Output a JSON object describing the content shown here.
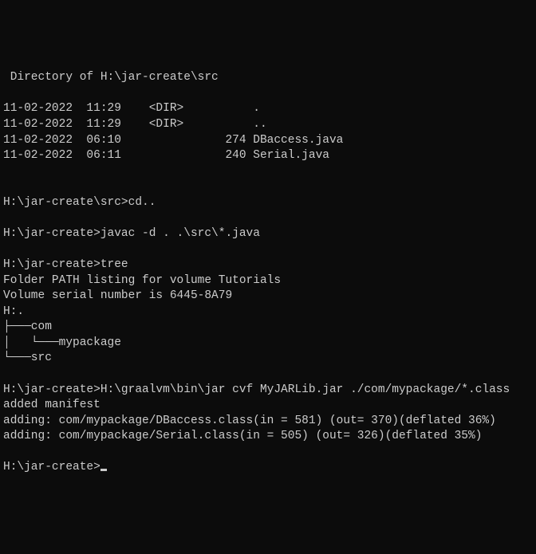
{
  "dir_header": " Directory of H:\\jar-create\\src",
  "listing": [
    "11-02-2022  11:29    <DIR>          .",
    "11-02-2022  11:29    <DIR>          ..",
    "11-02-2022  06:10               274 DBaccess.java",
    "11-02-2022  06:11               240 Serial.java"
  ],
  "cd_line": "H:\\jar-create\\src>cd..",
  "javac_line": "H:\\jar-create>javac -d . .\\src\\*.java",
  "tree_cmd": "H:\\jar-create>tree",
  "tree_out": [
    "Folder PATH listing for volume Tutorials",
    "Volume serial number is 6445-8A79",
    "H:.",
    "├───com",
    "│   └───mypackage",
    "└───src"
  ],
  "jar_cmd": "H:\\jar-create>H:\\graalvm\\bin\\jar cvf MyJARLib.jar ./com/mypackage/*.class",
  "jar_out": [
    "added manifest",
    "adding: com/mypackage/DBaccess.class(in = 581) (out= 370)(deflated 36%)",
    "adding: com/mypackage/Serial.class(in = 505) (out= 326)(deflated 35%)"
  ],
  "prompt": "H:\\jar-create>"
}
